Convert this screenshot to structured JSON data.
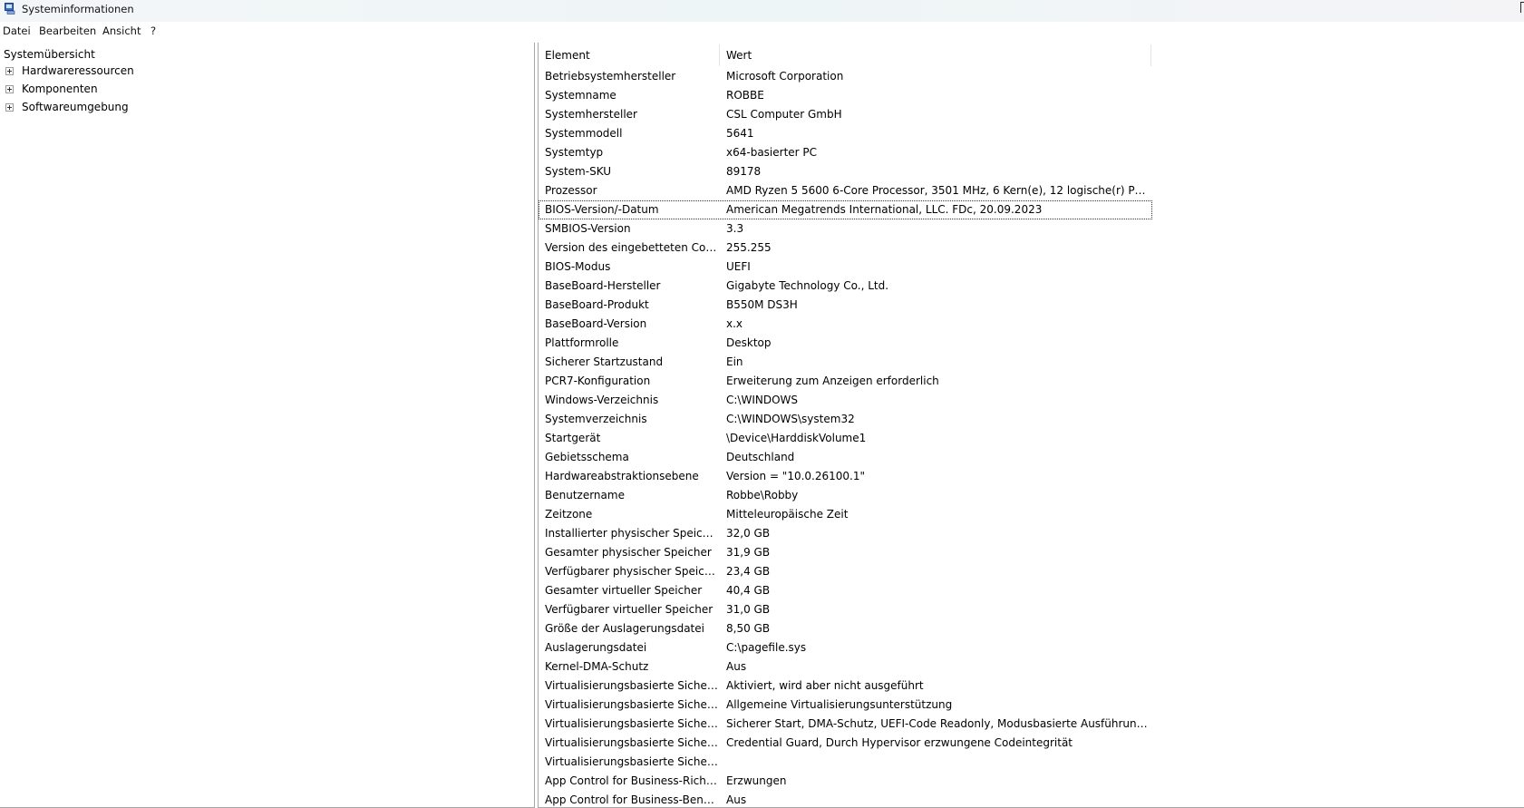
{
  "window": {
    "title": "Systeminformationen"
  },
  "menubar": {
    "items": [
      "Datei",
      "Bearbeiten",
      "Ansicht",
      "?"
    ]
  },
  "tree": {
    "root": "Systemübersicht",
    "children": [
      "Hardwareressourcen",
      "Komponenten",
      "Softwareumgebung"
    ]
  },
  "list": {
    "headers": {
      "element": "Element",
      "value": "Wert"
    },
    "selected_row": 7,
    "rows": [
      {
        "element": "Betriebsystemhersteller",
        "value": "Microsoft Corporation"
      },
      {
        "element": "Systemname",
        "value": "ROBBE"
      },
      {
        "element": "Systemhersteller",
        "value": "CSL Computer GmbH"
      },
      {
        "element": "Systemmodell",
        "value": "5641"
      },
      {
        "element": "Systemtyp",
        "value": "x64-basierter PC"
      },
      {
        "element": "System-SKU",
        "value": "89178"
      },
      {
        "element": "Prozessor",
        "value": "AMD Ryzen 5 5600 6-Core Processor, 3501 MHz, 6 Kern(e), 12 logische(r) Pro..."
      },
      {
        "element": "BIOS-Version/-Datum",
        "value": "American Megatrends International, LLC. FDc, 20.09.2023"
      },
      {
        "element": "SMBIOS-Version",
        "value": "3.3"
      },
      {
        "element": "Version des eingebetteten Cont...",
        "value": "255.255"
      },
      {
        "element": "BIOS-Modus",
        "value": "UEFI"
      },
      {
        "element": "BaseBoard-Hersteller",
        "value": "Gigabyte Technology Co., Ltd."
      },
      {
        "element": "BaseBoard-Produkt",
        "value": "B550M DS3H"
      },
      {
        "element": "BaseBoard-Version",
        "value": "x.x"
      },
      {
        "element": "Plattformrolle",
        "value": "Desktop"
      },
      {
        "element": "Sicherer Startzustand",
        "value": "Ein"
      },
      {
        "element": "PCR7-Konfiguration",
        "value": "Erweiterung zum Anzeigen erforderlich"
      },
      {
        "element": "Windows-Verzeichnis",
        "value": "C:\\WINDOWS"
      },
      {
        "element": "Systemverzeichnis",
        "value": "C:\\WINDOWS\\system32"
      },
      {
        "element": "Startgerät",
        "value": "\\Device\\HarddiskVolume1"
      },
      {
        "element": "Gebietsschema",
        "value": "Deutschland"
      },
      {
        "element": "Hardwareabstraktionsebene",
        "value": "Version = \"10.0.26100.1\""
      },
      {
        "element": "Benutzername",
        "value": "Robbe\\Robby"
      },
      {
        "element": "Zeitzone",
        "value": "Mitteleuropäische Zeit"
      },
      {
        "element": "Installierter physischer Speicher...",
        "value": "32,0 GB"
      },
      {
        "element": "Gesamter physischer Speicher",
        "value": "31,9 GB"
      },
      {
        "element": "Verfügbarer physischer Speicher",
        "value": "23,4 GB"
      },
      {
        "element": "Gesamter virtueller Speicher",
        "value": "40,4 GB"
      },
      {
        "element": "Verfügbarer virtueller Speicher",
        "value": "31,0 GB"
      },
      {
        "element": "Größe der Auslagerungsdatei",
        "value": "8,50 GB"
      },
      {
        "element": "Auslagerungsdatei",
        "value": "C:\\pagefile.sys"
      },
      {
        "element": "Kernel-DMA-Schutz",
        "value": "Aus"
      },
      {
        "element": "Virtualisierungsbasierte Sicherh...",
        "value": "Aktiviert, wird aber nicht ausgeführt"
      },
      {
        "element": "Virtualisierungsbasierte Sicherh...",
        "value": "Allgemeine Virtualisierungsunterstützung"
      },
      {
        "element": "Virtualisierungsbasierte Sicherh...",
        "value": "Sicherer Start, DMA-Schutz, UEFI-Code Readonly, Modusbasierte Ausführungs..."
      },
      {
        "element": "Virtualisierungsbasierte Sicherh...",
        "value": "Credential Guard, Durch Hypervisor erzwungene Codeintegrität"
      },
      {
        "element": "Virtualisierungsbasierte Sicherh...",
        "value": ""
      },
      {
        "element": "App Control for Business-Richtl...",
        "value": "Erzwungen"
      },
      {
        "element": "App Control for Business-Benut...",
        "value": "Aus"
      }
    ]
  },
  "colors": {
    "selection_outline": "#333333",
    "pane_border": "#a6a6a6"
  },
  "icons": {
    "app": "system-information-icon"
  }
}
